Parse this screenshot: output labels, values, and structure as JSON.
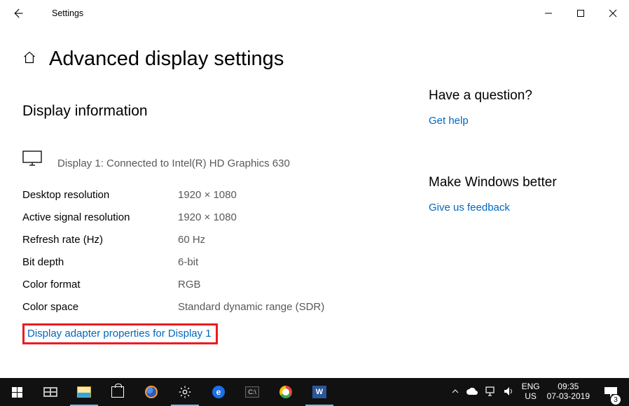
{
  "window": {
    "title": "Settings"
  },
  "page": {
    "heading": "Advanced display settings",
    "section_title": "Display information",
    "display_connected": "Display 1: Connected to Intel(R) HD Graphics 630",
    "rows": [
      {
        "label": "Desktop resolution",
        "value": "1920 × 1080"
      },
      {
        "label": "Active signal resolution",
        "value": "1920 × 1080"
      },
      {
        "label": "Refresh rate (Hz)",
        "value": "60 Hz"
      },
      {
        "label": "Bit depth",
        "value": "6-bit"
      },
      {
        "label": "Color format",
        "value": "RGB"
      },
      {
        "label": "Color space",
        "value": "Standard dynamic range (SDR)"
      }
    ],
    "adapter_link": "Display adapter properties for Display 1"
  },
  "sidebar": {
    "question_heading": "Have a question?",
    "get_help": "Get help",
    "improve_heading": "Make Windows better",
    "feedback": "Give us feedback"
  },
  "taskbar": {
    "lang_top": "ENG",
    "lang_bottom": "US",
    "time": "09:35",
    "date": "07-03-2019",
    "notification_count": "3"
  }
}
